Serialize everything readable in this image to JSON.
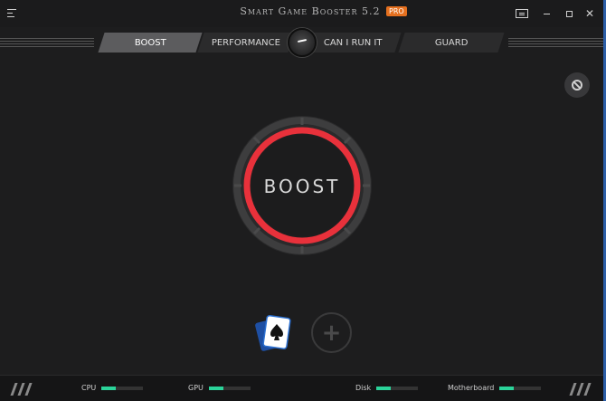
{
  "app": {
    "title": "Smart Game Booster 5.2",
    "badge": "PRO"
  },
  "tabs": [
    {
      "label": "BOOST",
      "active": true
    },
    {
      "label": "PERFORMANCE",
      "active": false
    },
    {
      "label": "CAN I RUN IT",
      "active": false
    },
    {
      "label": "GUARD",
      "active": false
    }
  ],
  "main": {
    "boost_label": "BOOST",
    "add_icon": "+"
  },
  "status": {
    "cpu": {
      "label": "CPU",
      "level": 0.35
    },
    "gpu": {
      "label": "GPU",
      "level": 0.35
    },
    "disk": {
      "label": "Disk",
      "level": 0.35
    },
    "motherboard": {
      "label": "Motherboard",
      "level": 0.35
    }
  },
  "colors": {
    "accent_red": "#e8313b",
    "meter_green": "#2bd49a",
    "pro_orange": "#e5701f",
    "window_border": "#2d5fa8"
  },
  "icons": [
    "menu-icon",
    "feedback-icon",
    "minimize-icon",
    "maximize-icon",
    "close-icon",
    "disable-icon",
    "solitaire-icon",
    "add-icon",
    "expand-icon"
  ]
}
